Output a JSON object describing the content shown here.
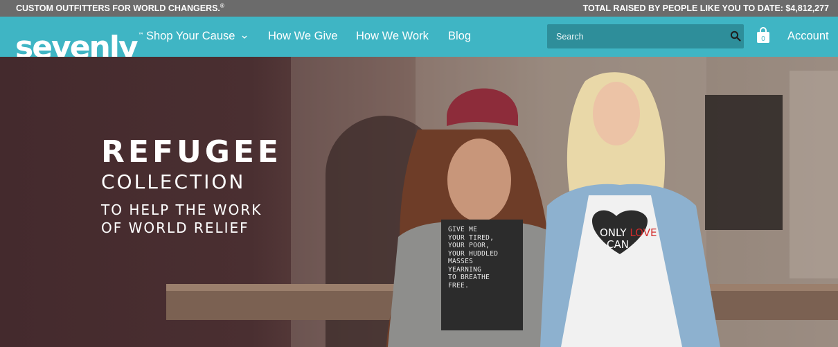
{
  "topbar": {
    "tagline": "CUSTOM OUTFITTERS FOR WORLD CHANGERS.",
    "tagline_mark": "®",
    "raised": "TOTAL RAISED BY PEOPLE LIKE YOU TO DATE: $4,812,277"
  },
  "nav": {
    "logo": "sevenly",
    "logo_mark": "™",
    "links": [
      "Shop Your Cause",
      "How We Give",
      "How We Work",
      "Blog"
    ],
    "search_placeholder": "Search",
    "cart_count": "0",
    "account": "Account"
  },
  "hero": {
    "title": "REFUGEE",
    "subtitle": "COLLECTION",
    "line1": "TO HELP THE WORK",
    "line2": "OF WORLD RELIEF",
    "shirt_left": [
      "GIVE ME",
      "YOUR TIRED,",
      "YOUR POOR,",
      "YOUR HUDDLED",
      "MASSES",
      "YEARNING",
      "TO BREATHE",
      "FREE."
    ],
    "shirt_right": [
      "ONLY",
      "LOVE",
      "CAN"
    ]
  },
  "colors": {
    "topbar": "#6b6b6b",
    "nav": "#3fb5c4",
    "search": "#2e8e9a",
    "hero_dark": "#442a2d"
  }
}
